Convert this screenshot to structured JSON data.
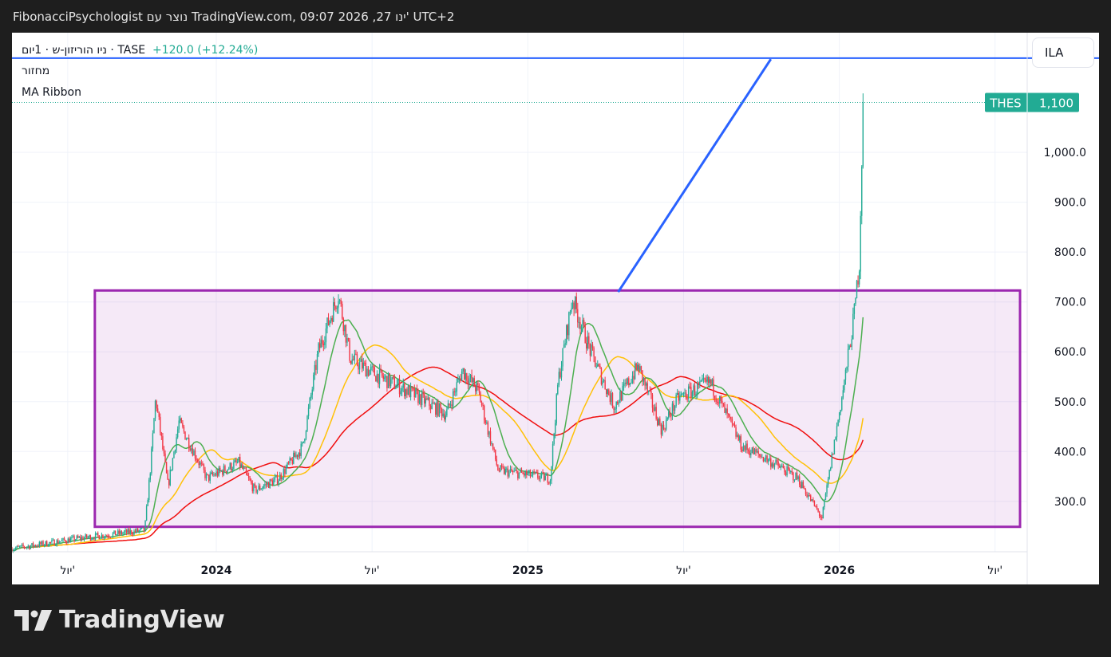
{
  "header": {
    "text": "FibonacciPsychologist נוצר עם TradingView.com, 09:07 2026 ,27 ינו' UTC+2"
  },
  "legend": {
    "symbol": "ניו הוריזון-ש · 1יום · TASE",
    "change": "+120.0 (+12.24%)",
    "indicator1": "מחזור",
    "indicator2": "MA Ribbon"
  },
  "currency_button": "ILA",
  "price_tag": {
    "symbol": "THES",
    "value": "1,100"
  },
  "logo": {
    "text": "TradingView"
  },
  "colors": {
    "up": "#22ab94",
    "down": "#f23645",
    "ma_short": "#4caf50",
    "ma_mid": "#ffc107",
    "ma_long": "#f00e0e",
    "box": "#9c27b0",
    "trend": "#2962ff"
  },
  "chart_data": {
    "type": "candlestick",
    "title": "ניו הוריזון-ש · 1יום · TASE",
    "xlim": [
      2023.344,
      2026.603
    ],
    "ylim": [
      199,
      1240
    ],
    "x_ticks": [
      {
        "v": 2023.523,
        "label": "יול'"
      },
      {
        "v": 2024.0,
        "label": "2024"
      },
      {
        "v": 2024.5,
        "label": "יול'"
      },
      {
        "v": 2025.0,
        "label": "2025"
      },
      {
        "v": 2025.5,
        "label": "יול'"
      },
      {
        "v": 2026.0,
        "label": "2026"
      },
      {
        "v": 2026.5,
        "label": "יול'"
      }
    ],
    "y_ticks": [
      300,
      400,
      500,
      600,
      700,
      800,
      900,
      1000
    ],
    "y_tick_labels": [
      "300.0",
      "400.0",
      "500.0",
      "600.0",
      "700.0",
      "800.0",
      "900.0",
      "1,000.0"
    ],
    "last_price": 1100,
    "price_path": [
      [
        2023.344,
        205
      ],
      [
        2023.56,
        226
      ],
      [
        2023.77,
        242
      ],
      [
        2023.79,
        378
      ],
      [
        2023.805,
        507
      ],
      [
        2023.845,
        330
      ],
      [
        2023.88,
        459
      ],
      [
        2023.97,
        346
      ],
      [
        2024.072,
        378
      ],
      [
        2024.123,
        322
      ],
      [
        2024.2,
        346
      ],
      [
        2024.277,
        410
      ],
      [
        2024.328,
        603
      ],
      [
        2024.392,
        715
      ],
      [
        2024.43,
        587
      ],
      [
        2024.51,
        555
      ],
      [
        2024.61,
        523
      ],
      [
        2024.738,
        475
      ],
      [
        2024.79,
        563
      ],
      [
        2024.84,
        523
      ],
      [
        2024.905,
        362
      ],
      [
        2024.995,
        354
      ],
      [
        2025.072,
        346
      ],
      [
        2025.097,
        539
      ],
      [
        2025.143,
        707
      ],
      [
        2025.2,
        603
      ],
      [
        2025.277,
        491
      ],
      [
        2025.354,
        571
      ],
      [
        2025.43,
        443
      ],
      [
        2025.482,
        507
      ],
      [
        2025.585,
        539
      ],
      [
        2025.636,
        475
      ],
      [
        2025.687,
        410
      ],
      [
        2025.764,
        386
      ],
      [
        2025.867,
        346
      ],
      [
        2025.944,
        266
      ],
      [
        2025.982,
        410
      ],
      [
        2026.02,
        555
      ],
      [
        2026.046,
        667
      ],
      [
        2026.064,
        779
      ],
      [
        2026.072,
        987
      ],
      [
        2026.077,
        1100
      ]
    ],
    "moving_averages": [
      {
        "name": "MA short",
        "period": 20
      },
      {
        "name": "MA mid",
        "period": 50
      },
      {
        "name": "MA long",
        "period": 100
      }
    ],
    "annotations": {
      "rectangle": {
        "x": [
          2023.61,
          2026.58
        ],
        "y": [
          249,
          723
        ]
      },
      "trendline": {
        "x": [
          2025.29,
          2025.78
        ],
        "y": [
          720,
          1187
        ]
      },
      "horizontal_line": {
        "y": 1189
      }
    }
  }
}
